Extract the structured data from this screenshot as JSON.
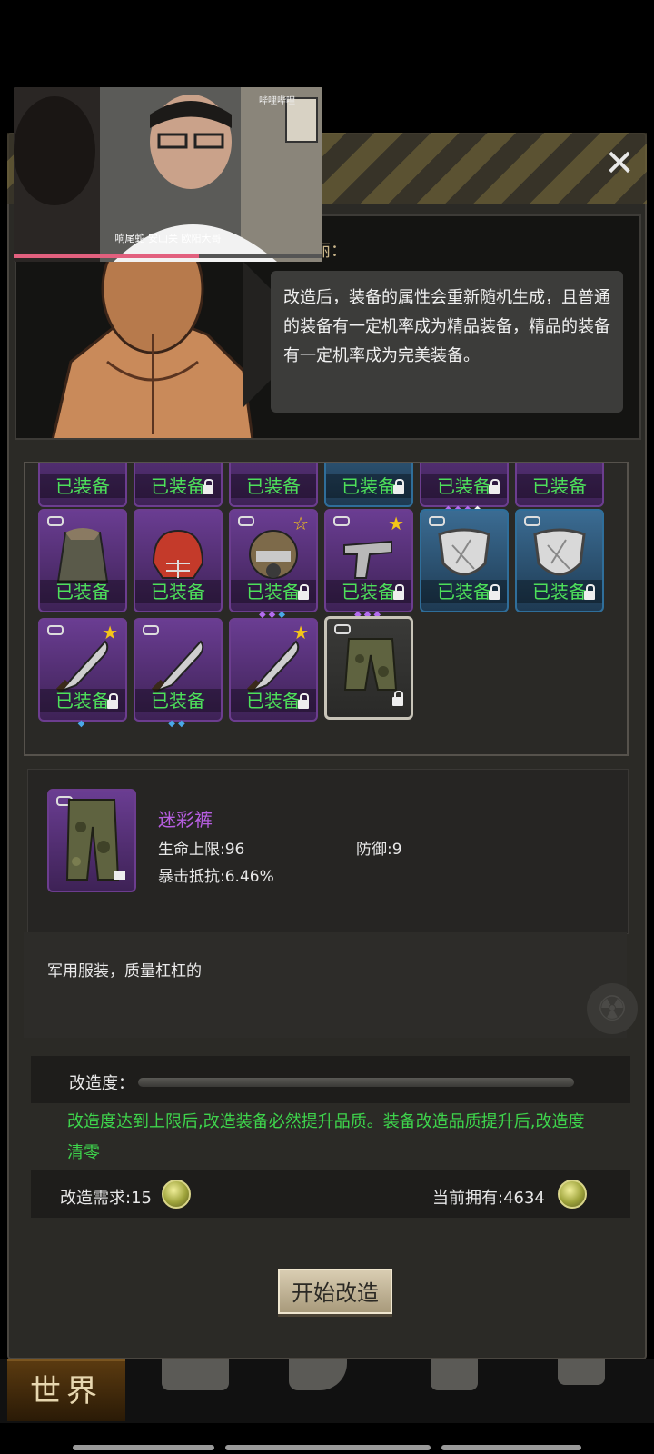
{
  "video": {
    "watermark": "哔哩哔哩",
    "subtitle": "响尾蛇  安山关  欧阳大哥",
    "progress": 0.6
  },
  "dialog": {
    "speaker_partial": "丽：",
    "text": "改造后，装备的属性会重新随机生成，且普通的装备有一定机率成为精品装备，精品的装备有一定机率成为完美装备。"
  },
  "inventory": {
    "equipped_label": "已装备",
    "selected_item": "迷彩裤"
  },
  "item": {
    "name": "迷彩裤",
    "stats": {
      "hp_label": "生命上限:96",
      "def_label": "防御:9",
      "crit_label": "暴击抵抗:6.46%"
    },
    "description": "军用服装，质量杠杠的"
  },
  "modify": {
    "progress_label": "改造度：",
    "progress": 0.0,
    "note": "改造度达到上限后,改造装备必然提升品质。装备改造品质提升后,改造度清零",
    "need_label": "改造需求:15",
    "have_label": "当前拥有:4634",
    "start_button": "开始改造"
  },
  "nav": {
    "world_label": "世界"
  },
  "colors": {
    "purple_quality": "#6a3d92",
    "blue_quality": "#3b6c93",
    "equipped_text": "#4de05a",
    "note_text": "#3ed44c",
    "item_name": "#b65ee0"
  }
}
